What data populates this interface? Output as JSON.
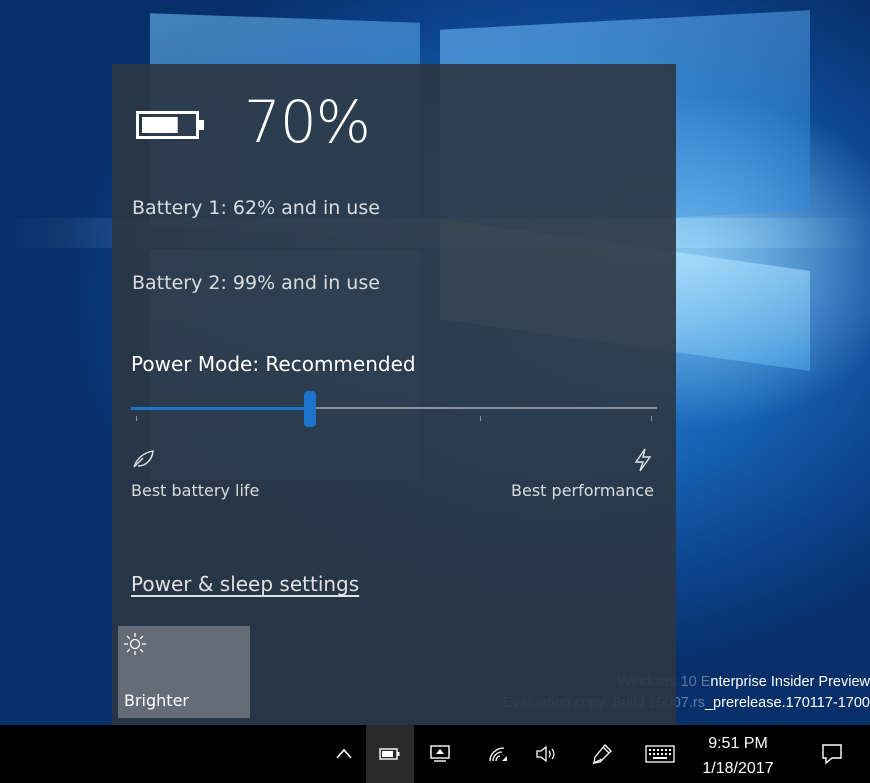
{
  "battery_flyout": {
    "overall_percent": "70%",
    "battery_level": 0.7,
    "batteries": [
      {
        "text": "Battery 1: 62% and in use"
      },
      {
        "text": "Battery 2: 99% and in use"
      }
    ],
    "power_mode_title": "Power Mode: Recommended",
    "power_mode_slider_value": 0.34,
    "slider_left_label": "Best battery life",
    "slider_right_label": "Best performance",
    "slider_left_icon": "leaf-icon",
    "slider_right_icon": "lightning-icon",
    "settings_link": "Power & sleep settings",
    "quick_action": {
      "label": "Brighter",
      "icon": "sun-icon"
    }
  },
  "desktop": {
    "watermark_line1": "Windows 10 Enterprise Insider Preview",
    "watermark_line2": "Evaluation copy. Build 15007.rs_prerelease.170117-1700"
  },
  "taskbar": {
    "icons": [
      "chevron-up-icon",
      "battery-icon",
      "project-icon",
      "network-icon",
      "volume-icon",
      "pen-icon",
      "keyboard-icon",
      "action-center-icon"
    ],
    "time": "9:51 PM",
    "date": "1/18/2017"
  },
  "colors": {
    "accent": "#1d74cc",
    "flyout_bg": "#2c3642",
    "taskbar_bg": "#000000"
  }
}
